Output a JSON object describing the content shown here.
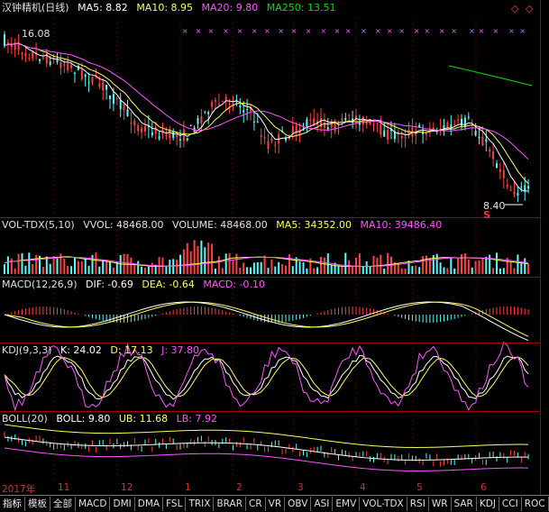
{
  "colors": {
    "up": "#ff4040",
    "down": "#54fcfc",
    "ma5": "#ffffff",
    "ma10": "#ffff54",
    "ma20": "#ff54ff",
    "ma250": "#00e000",
    "border": "#a00000"
  },
  "price_panel": {
    "stock_name": "汉钟精机(日线)",
    "ma5_label": "MA5: 8.82",
    "ma10_label": "MA10: 8.95",
    "ma20_label": "MA20: 9.80",
    "ma250_label": "MA250: 13.51",
    "high_label": "16.08",
    "low_label": "8.40",
    "s_marker": "S",
    "corner_icons": [
      "◇",
      "◇"
    ]
  },
  "volume_panel": {
    "title": "VOL-TDX(5,10)",
    "vvol": "VVOL: 48468.00",
    "volume": "VOLUME: 48468.00",
    "ma5": "MA5: 34352.00",
    "ma10": "MA10: 39486.40"
  },
  "macd_panel": {
    "title": "MACD(12,26,9)",
    "dif": "DIF: -0.69",
    "dea": "DEA: -0.64",
    "macd": "MACD: -0.10"
  },
  "kdj_panel": {
    "title": "KDJ(9,3,3)",
    "k": "K: 24.02",
    "d": "D: 17.13",
    "j": "J: 37.80"
  },
  "boll_panel": {
    "title": "BOLL(20)",
    "boll": "BOLL: 9.80",
    "ub": "UB: 11.68",
    "lb": "LB: 7.92"
  },
  "date_axis": [
    "2017年",
    "11",
    "12",
    "1",
    "2",
    "3",
    "4",
    "5",
    "6"
  ],
  "tabs": [
    "指标",
    "模板",
    "全部",
    "MACD",
    "DMI",
    "DMA",
    "FSL",
    "TRIX",
    "BRAR",
    "CR",
    "VR",
    "OBV",
    "ASI",
    "EMV",
    "VOL-TDX",
    "RSI",
    "WR",
    "SAR",
    "KDJ",
    "CCI",
    "ROC"
  ]
}
